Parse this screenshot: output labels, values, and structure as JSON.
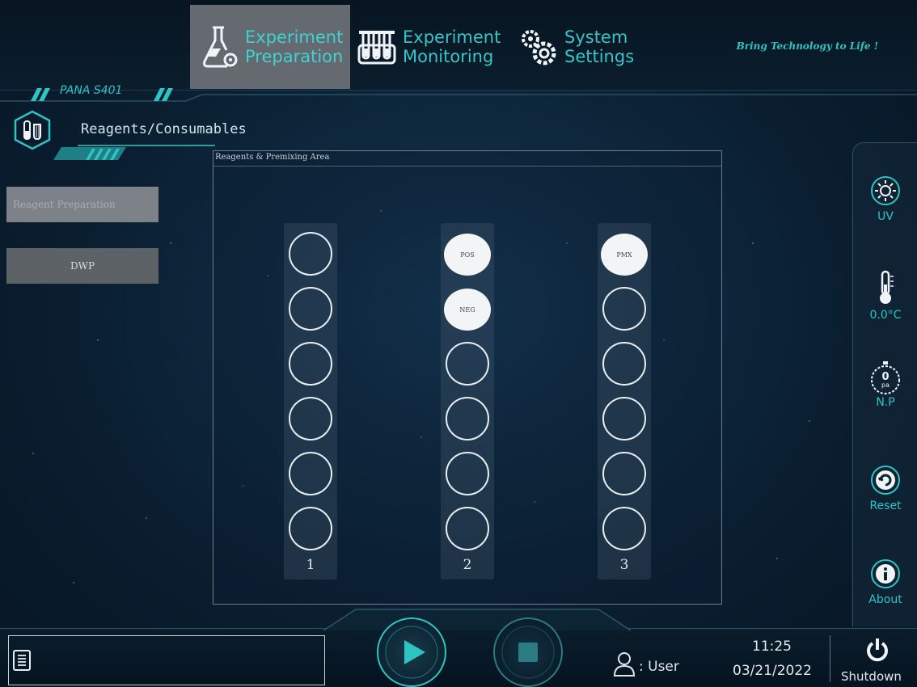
{
  "nav": {
    "tabs": [
      {
        "label": "Experiment\nPreparation",
        "icon": "flask-gear-icon",
        "active": true
      },
      {
        "label": "Experiment\nMonitoring",
        "icon": "test-tube-rack-icon",
        "active": false
      },
      {
        "label": "System\nSettings",
        "icon": "gears-icon",
        "active": false
      }
    ],
    "tagline": "Bring Technology to Life !"
  },
  "header": {
    "model": "PANA S401",
    "section_title": "Reagents/Consumables",
    "section_icon": "tubes-icon"
  },
  "left_menu": {
    "items": [
      {
        "label": "Reagent Preparation",
        "active": true
      },
      {
        "label": "DWP",
        "active": false
      }
    ]
  },
  "panel": {
    "title": "Reagents & Premixing Area",
    "columns": [
      {
        "number": "1",
        "wells": [
          "",
          "",
          "",
          "",
          "",
          ""
        ]
      },
      {
        "number": "2",
        "wells": [
          "POS",
          "NEG",
          "",
          "",
          "",
          ""
        ]
      },
      {
        "number": "3",
        "wells": [
          "PMX",
          "",
          "",
          "",
          "",
          ""
        ]
      }
    ]
  },
  "sidebar": {
    "uv": {
      "label": "UV",
      "icon": "uv-lamp-icon"
    },
    "temperature": {
      "label": "0.0°C",
      "icon": "thermometer-icon"
    },
    "pressure": {
      "value": "0",
      "unit": "pa",
      "label": "N.P",
      "icon": "pressure-gauge-icon"
    },
    "reset": {
      "label": "Reset",
      "icon": "reset-icon"
    },
    "about": {
      "label": "About",
      "icon": "info-icon"
    }
  },
  "bottom": {
    "user": {
      "label": ": User",
      "icon": "user-icon"
    },
    "time": "11:25",
    "date": "03/21/2022",
    "shutdown": {
      "label": "Shutdown",
      "icon": "power-icon"
    },
    "play_icon": "play-icon",
    "stop_icon": "stop-icon",
    "log_icon": "log-list-icon"
  },
  "colors": {
    "accent": "#2fc4c4",
    "active_tab": "#646a70",
    "background": "#0f2a40"
  }
}
